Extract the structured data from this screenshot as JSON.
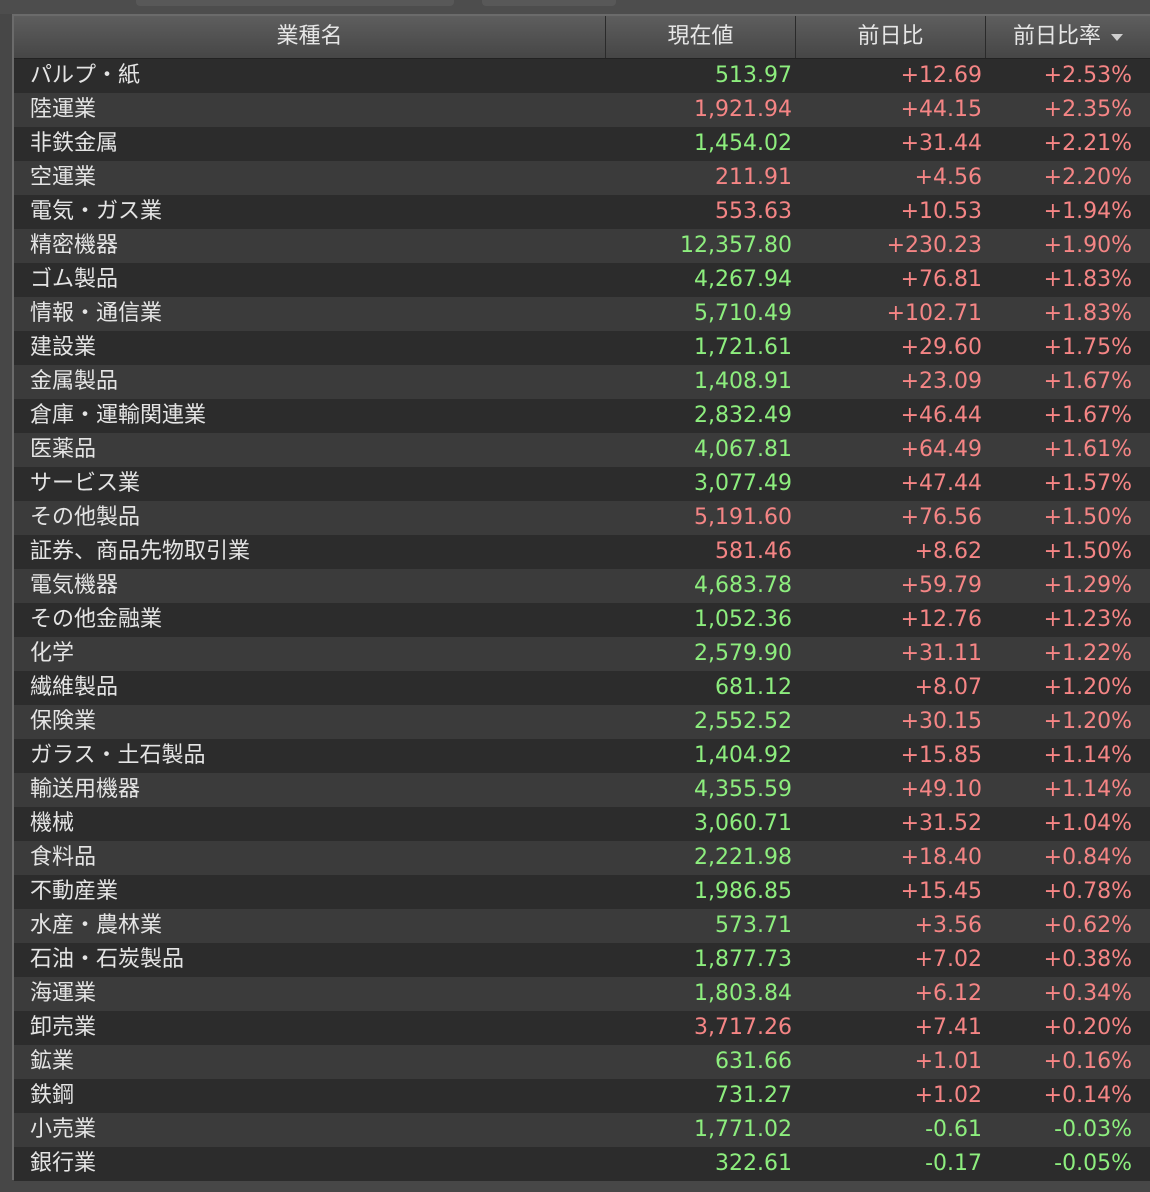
{
  "header": {
    "columns": [
      "業種名",
      "現在値",
      "前日比",
      "前日比率"
    ],
    "sorted_column": 3,
    "sort_direction": "descending"
  },
  "colors": {
    "up_price": "#8dee7e",
    "down_price": "#f58585",
    "positive_change": "#f58585",
    "negative_change": "#8dee7e"
  },
  "rows": [
    {
      "name": "パルプ・紙",
      "price": "513.97",
      "price_color": "green",
      "change": "+12.69",
      "change_color": "red",
      "pct": "+2.53%",
      "pct_color": "red"
    },
    {
      "name": "陸運業",
      "price": "1,921.94",
      "price_color": "red",
      "change": "+44.15",
      "change_color": "red",
      "pct": "+2.35%",
      "pct_color": "red"
    },
    {
      "name": "非鉄金属",
      "price": "1,454.02",
      "price_color": "green",
      "change": "+31.44",
      "change_color": "red",
      "pct": "+2.21%",
      "pct_color": "red"
    },
    {
      "name": "空運業",
      "price": "211.91",
      "price_color": "red",
      "change": "+4.56",
      "change_color": "red",
      "pct": "+2.20%",
      "pct_color": "red"
    },
    {
      "name": "電気・ガス業",
      "price": "553.63",
      "price_color": "red",
      "change": "+10.53",
      "change_color": "red",
      "pct": "+1.94%",
      "pct_color": "red"
    },
    {
      "name": "精密機器",
      "price": "12,357.80",
      "price_color": "green",
      "change": "+230.23",
      "change_color": "red",
      "pct": "+1.90%",
      "pct_color": "red"
    },
    {
      "name": "ゴム製品",
      "price": "4,267.94",
      "price_color": "green",
      "change": "+76.81",
      "change_color": "red",
      "pct": "+1.83%",
      "pct_color": "red"
    },
    {
      "name": "情報・通信業",
      "price": "5,710.49",
      "price_color": "green",
      "change": "+102.71",
      "change_color": "red",
      "pct": "+1.83%",
      "pct_color": "red"
    },
    {
      "name": "建設業",
      "price": "1,721.61",
      "price_color": "green",
      "change": "+29.60",
      "change_color": "red",
      "pct": "+1.75%",
      "pct_color": "red"
    },
    {
      "name": "金属製品",
      "price": "1,408.91",
      "price_color": "green",
      "change": "+23.09",
      "change_color": "red",
      "pct": "+1.67%",
      "pct_color": "red"
    },
    {
      "name": "倉庫・運輸関連業",
      "price": "2,832.49",
      "price_color": "green",
      "change": "+46.44",
      "change_color": "red",
      "pct": "+1.67%",
      "pct_color": "red"
    },
    {
      "name": "医薬品",
      "price": "4,067.81",
      "price_color": "green",
      "change": "+64.49",
      "change_color": "red",
      "pct": "+1.61%",
      "pct_color": "red"
    },
    {
      "name": "サービス業",
      "price": "3,077.49",
      "price_color": "green",
      "change": "+47.44",
      "change_color": "red",
      "pct": "+1.57%",
      "pct_color": "red"
    },
    {
      "name": "その他製品",
      "price": "5,191.60",
      "price_color": "red",
      "change": "+76.56",
      "change_color": "red",
      "pct": "+1.50%",
      "pct_color": "red"
    },
    {
      "name": "証券、商品先物取引業",
      "price": "581.46",
      "price_color": "red",
      "change": "+8.62",
      "change_color": "red",
      "pct": "+1.50%",
      "pct_color": "red"
    },
    {
      "name": "電気機器",
      "price": "4,683.78",
      "price_color": "green",
      "change": "+59.79",
      "change_color": "red",
      "pct": "+1.29%",
      "pct_color": "red"
    },
    {
      "name": "その他金融業",
      "price": "1,052.36",
      "price_color": "green",
      "change": "+12.76",
      "change_color": "red",
      "pct": "+1.23%",
      "pct_color": "red"
    },
    {
      "name": "化学",
      "price": "2,579.90",
      "price_color": "green",
      "change": "+31.11",
      "change_color": "red",
      "pct": "+1.22%",
      "pct_color": "red"
    },
    {
      "name": "繊維製品",
      "price": "681.12",
      "price_color": "green",
      "change": "+8.07",
      "change_color": "red",
      "pct": "+1.20%",
      "pct_color": "red"
    },
    {
      "name": "保険業",
      "price": "2,552.52",
      "price_color": "green",
      "change": "+30.15",
      "change_color": "red",
      "pct": "+1.20%",
      "pct_color": "red"
    },
    {
      "name": "ガラス・土石製品",
      "price": "1,404.92",
      "price_color": "green",
      "change": "+15.85",
      "change_color": "red",
      "pct": "+1.14%",
      "pct_color": "red"
    },
    {
      "name": "輸送用機器",
      "price": "4,355.59",
      "price_color": "green",
      "change": "+49.10",
      "change_color": "red",
      "pct": "+1.14%",
      "pct_color": "red"
    },
    {
      "name": "機械",
      "price": "3,060.71",
      "price_color": "green",
      "change": "+31.52",
      "change_color": "red",
      "pct": "+1.04%",
      "pct_color": "red"
    },
    {
      "name": "食料品",
      "price": "2,221.98",
      "price_color": "green",
      "change": "+18.40",
      "change_color": "red",
      "pct": "+0.84%",
      "pct_color": "red"
    },
    {
      "name": "不動産業",
      "price": "1,986.85",
      "price_color": "green",
      "change": "+15.45",
      "change_color": "red",
      "pct": "+0.78%",
      "pct_color": "red"
    },
    {
      "name": "水産・農林業",
      "price": "573.71",
      "price_color": "green",
      "change": "+3.56",
      "change_color": "red",
      "pct": "+0.62%",
      "pct_color": "red"
    },
    {
      "name": "石油・石炭製品",
      "price": "1,877.73",
      "price_color": "green",
      "change": "+7.02",
      "change_color": "red",
      "pct": "+0.38%",
      "pct_color": "red"
    },
    {
      "name": "海運業",
      "price": "1,803.84",
      "price_color": "green",
      "change": "+6.12",
      "change_color": "red",
      "pct": "+0.34%",
      "pct_color": "red"
    },
    {
      "name": "卸売業",
      "price": "3,717.26",
      "price_color": "red",
      "change": "+7.41",
      "change_color": "red",
      "pct": "+0.20%",
      "pct_color": "red"
    },
    {
      "name": "鉱業",
      "price": "631.66",
      "price_color": "green",
      "change": "+1.01",
      "change_color": "red",
      "pct": "+0.16%",
      "pct_color": "red"
    },
    {
      "name": "鉄鋼",
      "price": "731.27",
      "price_color": "green",
      "change": "+1.02",
      "change_color": "red",
      "pct": "+0.14%",
      "pct_color": "red"
    },
    {
      "name": "小売業",
      "price": "1,771.02",
      "price_color": "green",
      "change": "-0.61",
      "change_color": "green",
      "pct": "-0.03%",
      "pct_color": "green"
    },
    {
      "name": "銀行業",
      "price": "322.61",
      "price_color": "green",
      "change": "-0.17",
      "change_color": "green",
      "pct": "-0.05%",
      "pct_color": "green"
    }
  ]
}
